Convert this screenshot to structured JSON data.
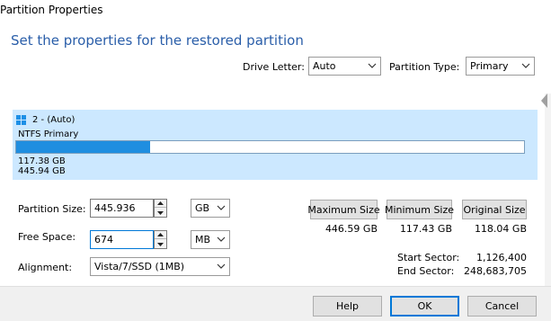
{
  "window": {
    "title": "Partition Properties"
  },
  "heading": "Set the properties for the restored partition",
  "drive_letter": {
    "label": "Drive Letter:",
    "value": "Auto"
  },
  "partition_type": {
    "label": "Partition Type:",
    "value": "Primary"
  },
  "partition": {
    "name": "2 - (Auto)",
    "fs_type": "NTFS Primary",
    "used": "117.38 GB",
    "total": "445.94 GB",
    "used_fraction": 0.263
  },
  "partition_size": {
    "label": "Partition Size:",
    "value": "445.936",
    "unit": "GB"
  },
  "free_space": {
    "label": "Free Space:",
    "value": "674",
    "unit": "MB"
  },
  "alignment": {
    "label": "Alignment:",
    "value": "Vista/7/SSD (1MB)"
  },
  "size_buttons": [
    {
      "label": "Maximum Size",
      "value": "446.59 GB"
    },
    {
      "label": "Minimum Size",
      "value": "117.43 GB"
    },
    {
      "label": "Original Size",
      "value": "118.04 GB"
    }
  ],
  "sectors": {
    "start_label": "Start Sector:",
    "start_value": "1,126,400",
    "end_label": "End Sector:",
    "end_value": "248,683,705"
  },
  "footer": {
    "help": "Help",
    "ok": "OK",
    "cancel": "Cancel"
  },
  "colors": {
    "accent": "#0078d7",
    "heading": "#2a5ea9",
    "panel": "#cce8ff",
    "bar": "#1f8ee0"
  },
  "icons": {
    "partition": "windows-logo-icon",
    "dropdown": "chevron-down-icon"
  }
}
